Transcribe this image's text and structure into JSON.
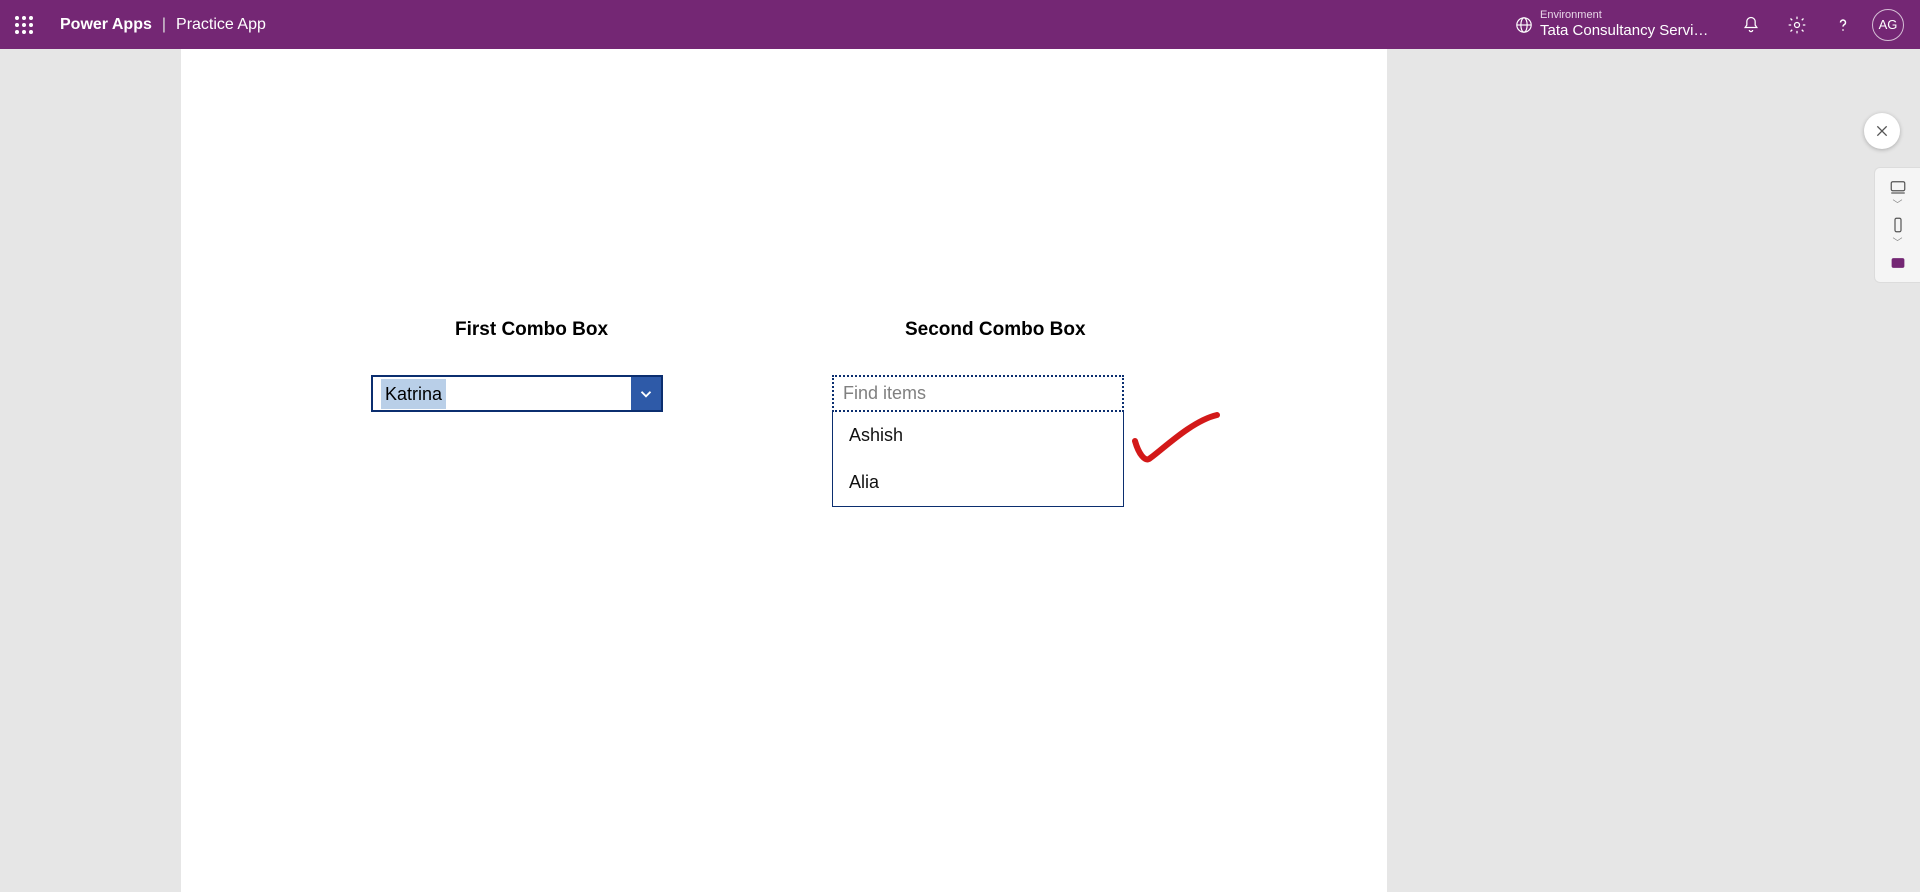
{
  "header": {
    "brand": "Power Apps",
    "separator": "|",
    "app_name": "Practice App",
    "environment_label": "Environment",
    "environment_value": "Tata Consultancy Servic...",
    "avatar_initials": "AG"
  },
  "canvas": {
    "combo1": {
      "label": "First Combo Box",
      "selected": "Katrina"
    },
    "combo2": {
      "label": "Second Combo Box",
      "placeholder": "Find items",
      "items": [
        "Ashish",
        "Alia"
      ]
    }
  },
  "icons": {
    "waffle": "app-launcher-icon",
    "globe": "environment-icon",
    "bell": "notifications-icon",
    "gear": "settings-icon",
    "help": "help-icon",
    "close": "close-icon",
    "desktop": "desktop-device-icon",
    "phone": "phone-device-icon",
    "custom": "custom-device-icon"
  }
}
